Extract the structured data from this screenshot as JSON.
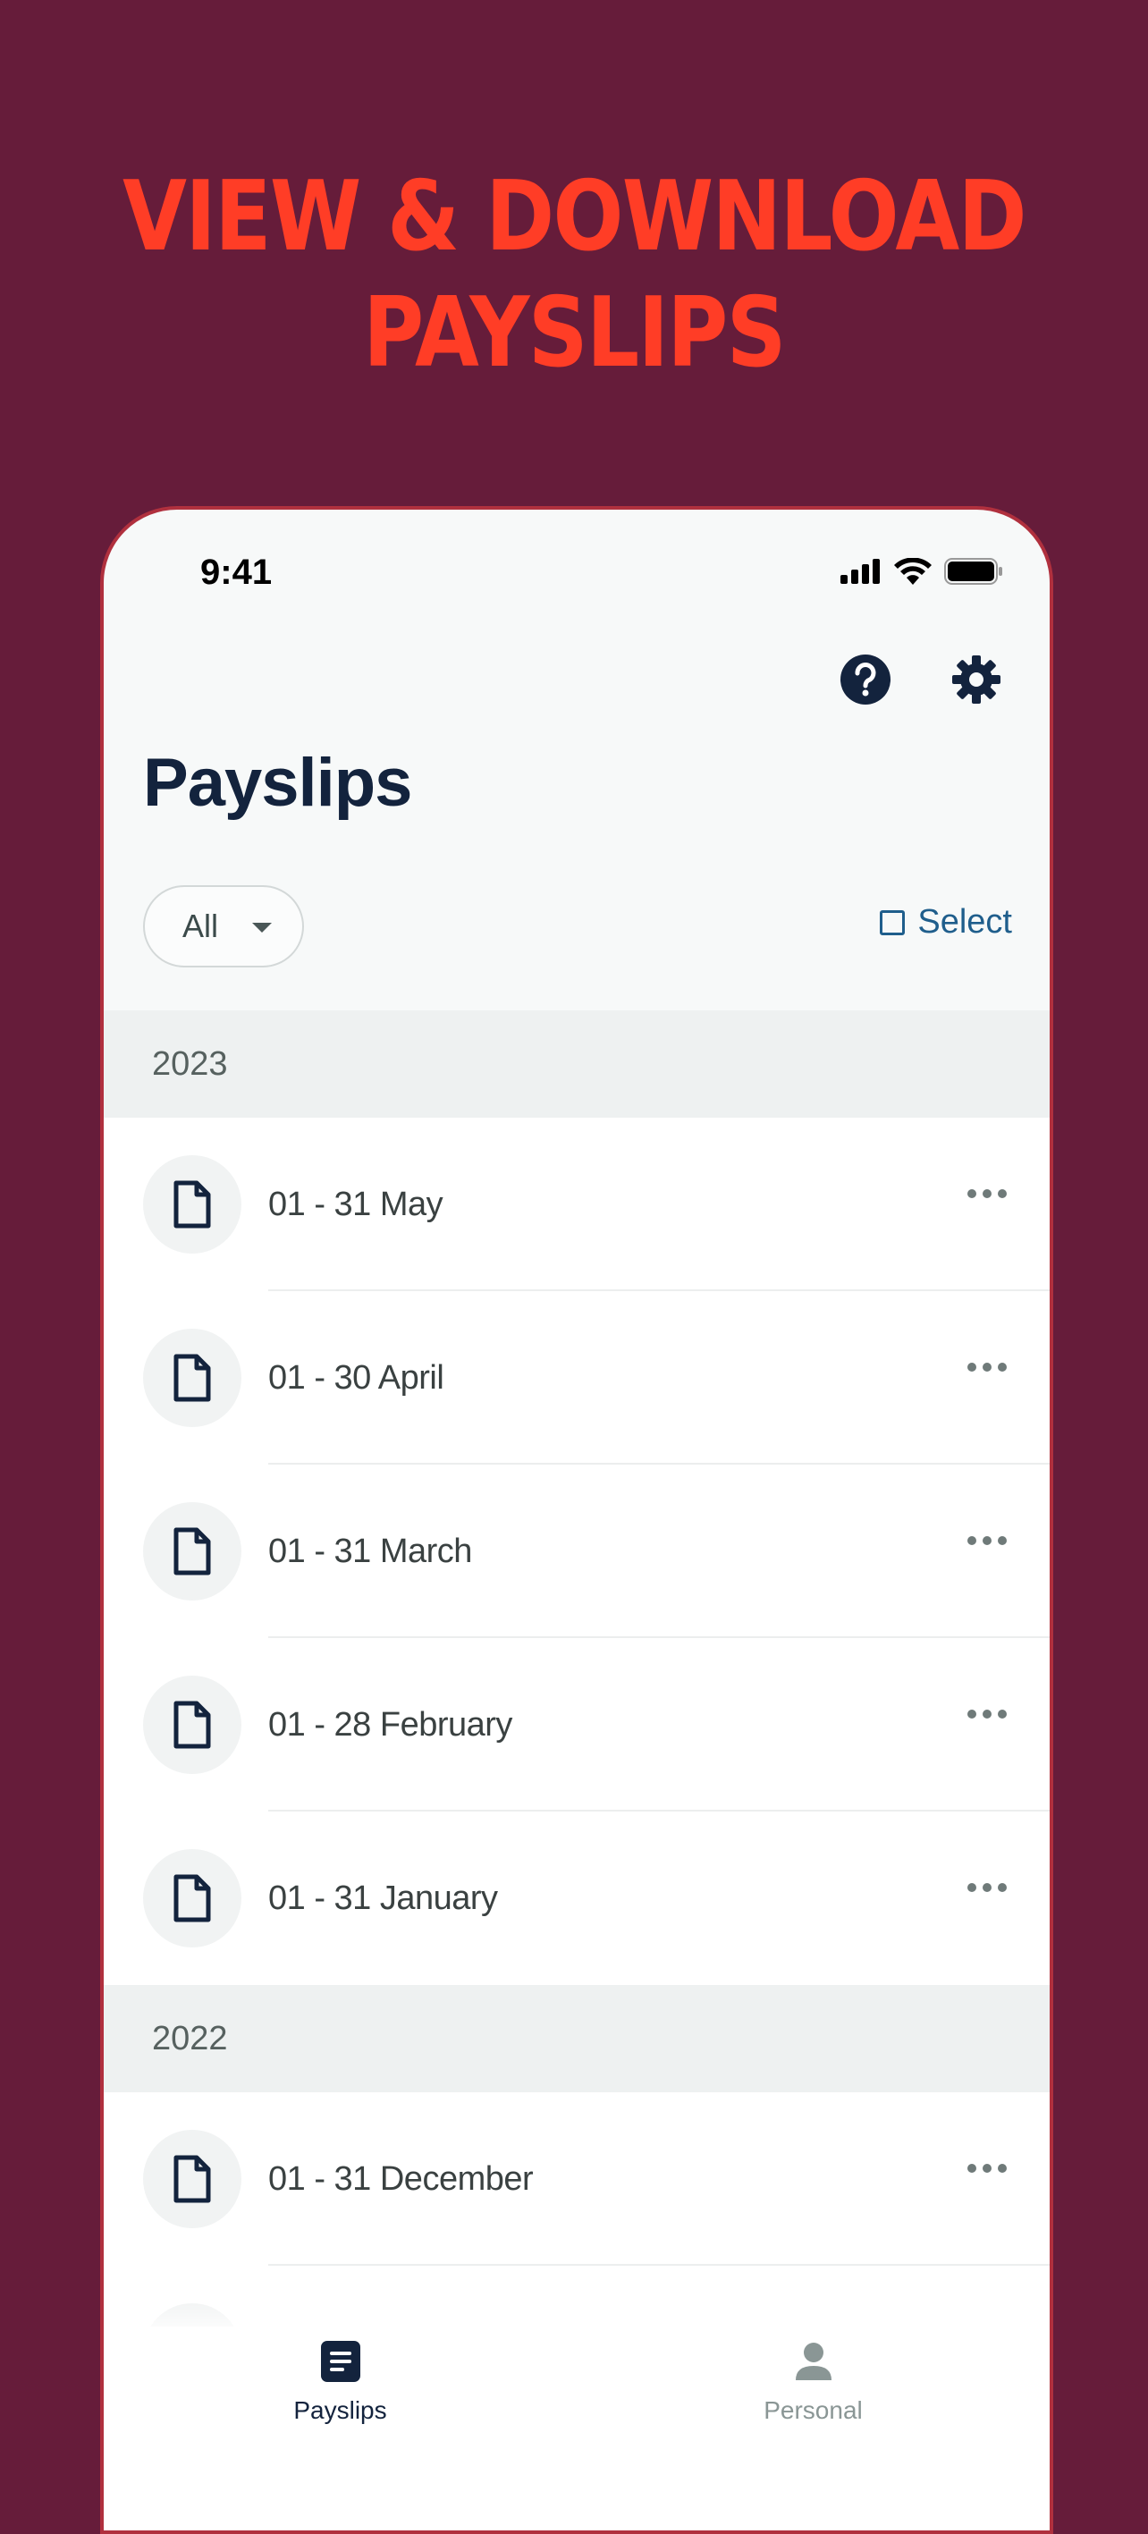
{
  "headline": {
    "line1": "VIEW & DOWNLOAD",
    "line2": "PAYSLIPS"
  },
  "colors": {
    "background": "#661c3a",
    "headline": "#ff3d26",
    "title": "#13233d",
    "link": "#1f5e8c"
  },
  "status_bar": {
    "time": "9:41"
  },
  "header": {
    "help_icon": "question-circle-icon",
    "settings_icon": "gear-icon"
  },
  "page_title": "Payslips",
  "filter": {
    "selected": "All"
  },
  "select_label": "Select",
  "sections": [
    {
      "year": "2023",
      "items": [
        "01 - 31 May",
        "01 - 30 April",
        "01 - 31 March",
        "01 - 28 February",
        "01 - 31 January"
      ]
    },
    {
      "year": "2022",
      "items": [
        "01 - 31 December"
      ]
    }
  ],
  "tabs": [
    {
      "label": "Payslips",
      "icon": "payslips-icon",
      "active": true
    },
    {
      "label": "Personal",
      "icon": "person-icon",
      "active": false
    }
  ]
}
